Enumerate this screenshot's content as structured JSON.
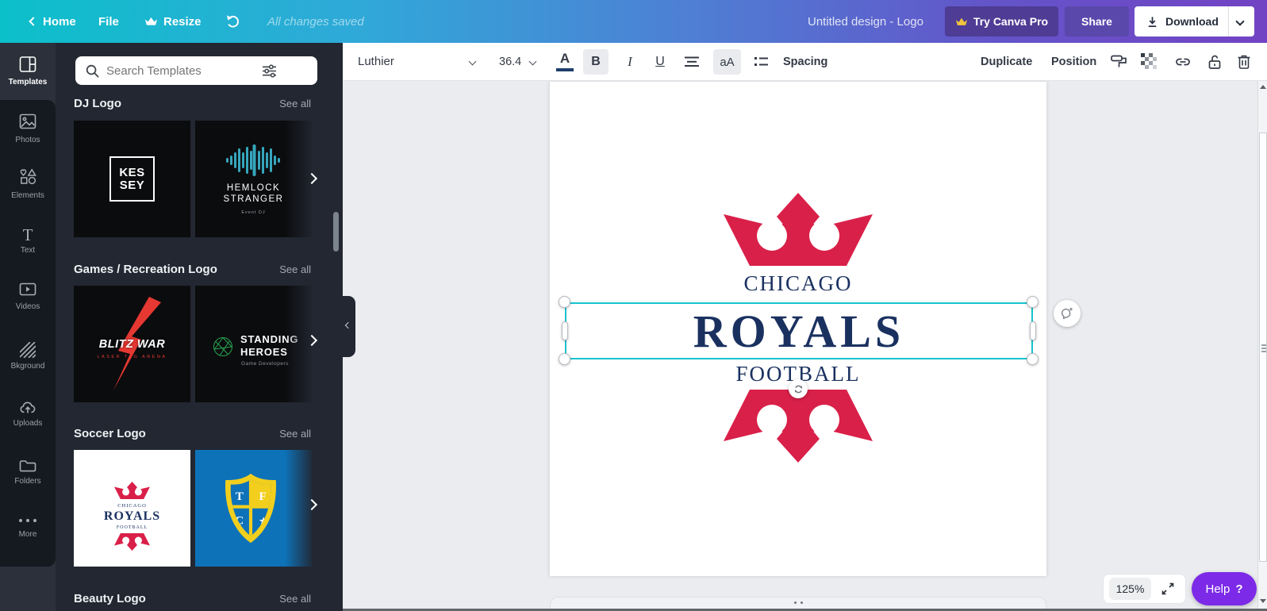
{
  "header": {
    "home": "Home",
    "file": "File",
    "resize": "Resize",
    "saved": "All changes saved",
    "title": "Untitled design - Logo",
    "try_pro": "Try Canva Pro",
    "share": "Share",
    "download": "Download"
  },
  "toolbar": {
    "font_name": "Luthier",
    "font_size": "36.4",
    "color_letter": "A",
    "bold": "B",
    "italic": "I",
    "underline": "U",
    "case_toggle": "aA",
    "spacing": "Spacing",
    "duplicate": "Duplicate",
    "position": "Position"
  },
  "sidebar": {
    "items": [
      {
        "label": "Templates"
      },
      {
        "label": "Photos"
      },
      {
        "label": "Elements"
      },
      {
        "label": "Text"
      },
      {
        "label": "Videos"
      },
      {
        "label": "Bkground"
      },
      {
        "label": "Uploads"
      },
      {
        "label": "Folders"
      },
      {
        "label": "More"
      }
    ],
    "text_icon_glyph": "T"
  },
  "panel": {
    "search_placeholder": "Search Templates",
    "sections": [
      {
        "title": "DJ Logo",
        "see_all": "See all"
      },
      {
        "title": "Games / Recreation Logo",
        "see_all": "See all"
      },
      {
        "title": "Soccer Logo",
        "see_all": "See all"
      },
      {
        "title": "Beauty Logo",
        "see_all": "See all"
      }
    ],
    "thumbs": {
      "kessey": {
        "line1": "KES",
        "line2": "SEY"
      },
      "hemlock": {
        "line1": "HEMLOCK",
        "line2": "STRANGER",
        "sub": "Event DJ"
      },
      "blitz": {
        "title": "BLITZ WAR",
        "sub": "LASER TAG ARENA"
      },
      "standing": {
        "line1": "STANDING",
        "line2": "HEROES",
        "sub": "Game Developers"
      },
      "royals": {
        "top": "CHICAGO",
        "name": "ROYALS",
        "bottom": "FOOTBALL"
      },
      "shield": {
        "tl": "T",
        "tr": "F",
        "bl": "C",
        "star": "★"
      }
    }
  },
  "canvas": {
    "logo": {
      "top": "CHICAGO",
      "name": "ROYALS",
      "bottom": "FOOTBALL"
    },
    "zoom_level": "125%",
    "help_label": "Help",
    "help_mark": "?"
  },
  "colors": {
    "navy": "#1a3160",
    "red": "#d92049",
    "cyan": "#17c3ce",
    "purple": "#7c2ae8"
  }
}
